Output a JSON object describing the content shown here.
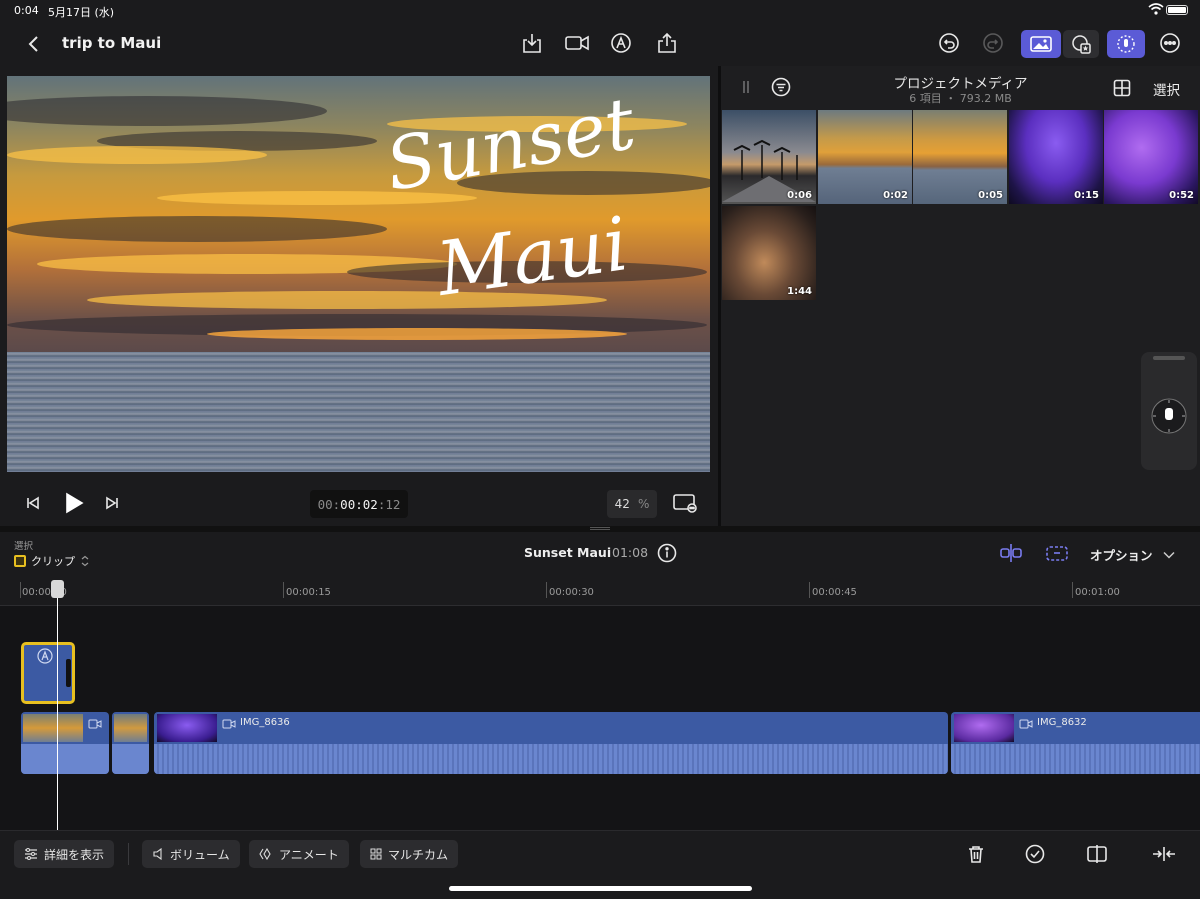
{
  "status": {
    "time": "0:04",
    "date": "5月17日 (水)"
  },
  "header": {
    "title": "trip to Maui"
  },
  "viewer": {
    "overlay_line1": "Sunset",
    "overlay_line2": "Maui",
    "timecode_dim": "00:",
    "timecode": "00:02",
    "timecode_frames": ":12",
    "zoom": "42",
    "zoom_unit": "%"
  },
  "browser": {
    "title": "プロジェクトメディア",
    "subtitle": "6 項目 ・ 793.2 MB",
    "select_label": "選択",
    "items": [
      {
        "duration": "0:06"
      },
      {
        "duration": "0:02"
      },
      {
        "duration": "0:05"
      },
      {
        "duration": "0:15"
      },
      {
        "duration": "0:52"
      },
      {
        "duration": "1:44"
      }
    ]
  },
  "timeline_header": {
    "mode_caption": "選択",
    "mode_value": "クリップ",
    "project_name": "Sunset Maui",
    "project_duration": "01:08",
    "options_label": "オプション"
  },
  "ruler": {
    "labels": [
      "00:00:00",
      "00:00:15",
      "00:00:30",
      "00:00:45",
      "00:01:00"
    ]
  },
  "clips": {
    "clip3_name": "IMG_8636",
    "clip4_name": "IMG_8632"
  },
  "toolbar": {
    "details": "詳細を表示",
    "volume": "ボリューム",
    "animate": "アニメート",
    "multicam": "マルチカム"
  },
  "colors": {
    "accent": "#5b5bd6",
    "clip_blue": "#3c5aa3",
    "title_clip": "#e8c020"
  }
}
